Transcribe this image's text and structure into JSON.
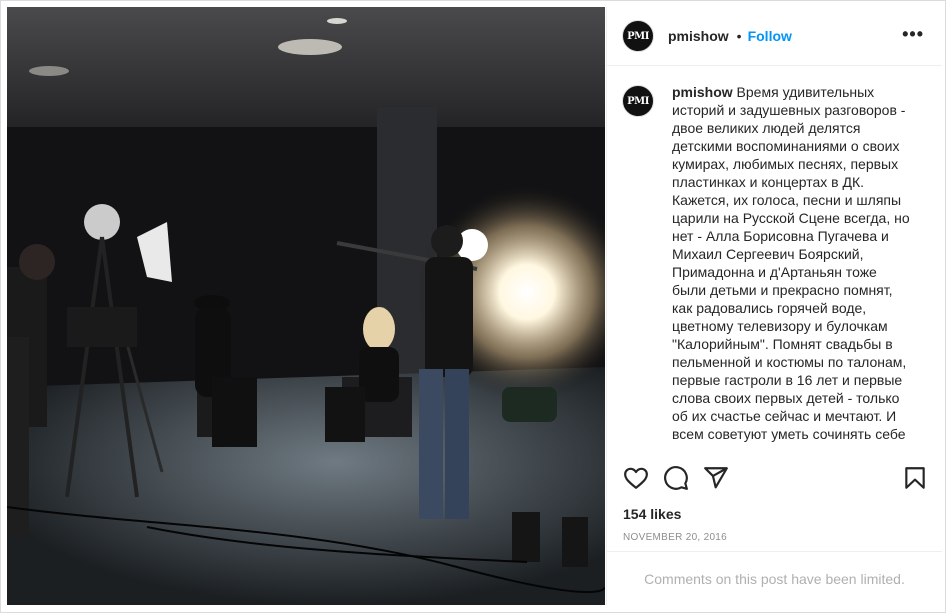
{
  "post": {
    "username": "pmishow",
    "avatar_text": "PMI",
    "follow_label": "Follow",
    "separator": "•",
    "more_label": "•••",
    "caption_username": "pmishow",
    "caption_text": " Время удивительных историй и задушевных разговоров - двое великих людей делятся детскими воспоминаниями о своих кумирах, любимых песнях, первых пластинках и концертах в ДК. Кажется, их голоса, песни и шляпы царили на Русской Сцене всегда, но нет - Алла Борисовна Пугачева и Михаил Сергеевич Боярский, Примадонна и д'Артаньян тоже были детьми и прекрасно помнят, как радовались горячей воде, цветному телевизору и булочкам \"Калорийным\". Помнят свадьбы в пельменной и костюмы по талонам, первые гастроли в 16 лет и первые слова своих первых детей - только об их счастье сейчас и мечтают. И всем советуют уметь сочинять себе",
    "likes": "154 likes",
    "date": "NOVEMBER 20, 2016",
    "comments_notice": "Comments on this post have been limited."
  },
  "icons": {
    "like": "heart-icon",
    "comment": "comment-icon",
    "share": "share-icon",
    "save": "bookmark-icon"
  },
  "colors": {
    "accent": "#0095f6",
    "text": "#262626",
    "muted": "#8e8e8e"
  }
}
